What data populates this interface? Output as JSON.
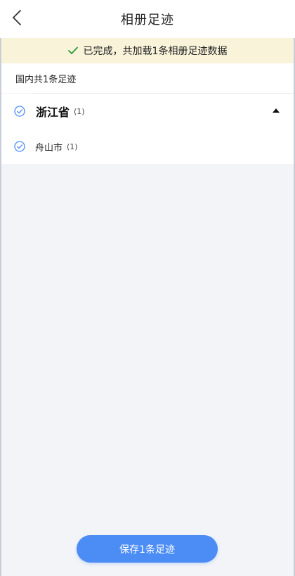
{
  "header": {
    "title": "相册足迹",
    "back_icon": "chevron-left-icon"
  },
  "banner": {
    "text": "已完成，共加载1条相册足迹数据",
    "icon": "check-icon",
    "icon_color": "#2e9a3a"
  },
  "summary": {
    "text": "国内共1条足迹"
  },
  "regions": [
    {
      "name": "浙江省",
      "count": "(1)",
      "checked": true,
      "expanded": true,
      "cities": [
        {
          "name": "舟山市",
          "count": "(1)",
          "checked": true
        }
      ]
    }
  ],
  "footer": {
    "save_label": "保存1条足迹"
  },
  "colors": {
    "accent": "#4c8cf5",
    "banner_bg": "#f8f3d9",
    "page_bg": "#f2f4f8"
  }
}
